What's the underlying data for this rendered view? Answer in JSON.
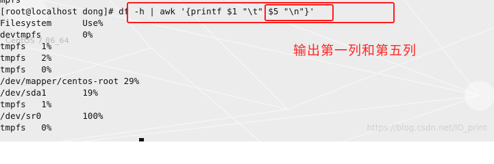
{
  "terminal": {
    "top_partial": "mpfs",
    "prompt": "[root@localhost dong]#",
    "command": " df -h | awk '{printf $1 \"\\t\" $5 \"\\n\"}'",
    "output": [
      "Filesystem      Use%",
      "devtmpfs        0%",
      "tmpfs   1%",
      "tmpfs   2%",
      "tmpfs   0%",
      "/dev/mapper/centos-root 29%",
      "/dev/sda1       19%",
      "tmpfs   1%",
      "/dev/sr0        100%",
      "tmpfs   0%"
    ]
  },
  "overlay": {
    "os_watermark": "CentOS 7 86_64",
    "annotation": "输出第一列和第五列",
    "blog_watermark": "https://blog.csdn.net/IO_print",
    "accent_color": "#ff1a1a"
  }
}
